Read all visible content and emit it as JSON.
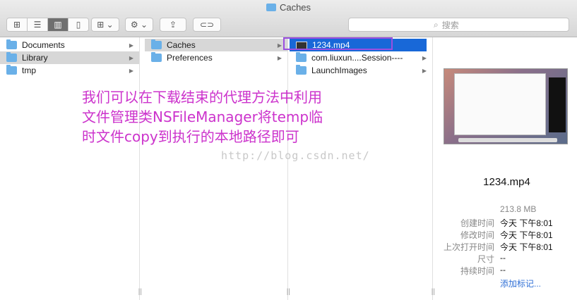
{
  "window": {
    "title": "Caches"
  },
  "toolbar": {
    "view_icons": "⊞",
    "view_list": "☰",
    "view_columns": "▥",
    "view_coverflow": "▯",
    "arrange": "⊞ ⌄",
    "action": "⚙ ⌄",
    "share": "⇪",
    "tag": "⊂⊃",
    "search_placeholder": "搜索",
    "search_icon": "⌕"
  },
  "columns": [
    {
      "items": [
        {
          "label": "Documents"
        },
        {
          "label": "Library"
        },
        {
          "label": "tmp"
        }
      ]
    },
    {
      "items": [
        {
          "label": "Caches"
        },
        {
          "label": "Preferences"
        }
      ]
    },
    {
      "items": [
        {
          "label": "1234.mp4"
        },
        {
          "label": "com.liuxun....Session----"
        },
        {
          "label": "LaunchImages"
        }
      ]
    }
  ],
  "arrow": "▶",
  "grip": "||",
  "preview": {
    "file_name": "1234.mp4",
    "size": "213.8 MB",
    "rows": [
      {
        "key": "创建时间",
        "value": "今天 下午8:01"
      },
      {
        "key": "修改时间",
        "value": "今天 下午8:01"
      },
      {
        "key": "上次打开时间",
        "value": "今天 下午8:01"
      },
      {
        "key": "尺寸",
        "value": "--"
      },
      {
        "key": "持续时间",
        "value": "--"
      }
    ],
    "add_tags": "添加标记..."
  },
  "annotation": {
    "line1": "我们可以在下载结束的代理方法中利用",
    "line2": "文件管理类NSFileManager将temp临",
    "line3": "时文件copy到执行的本地路径即可"
  },
  "watermark": "http://blog.csdn.net/"
}
